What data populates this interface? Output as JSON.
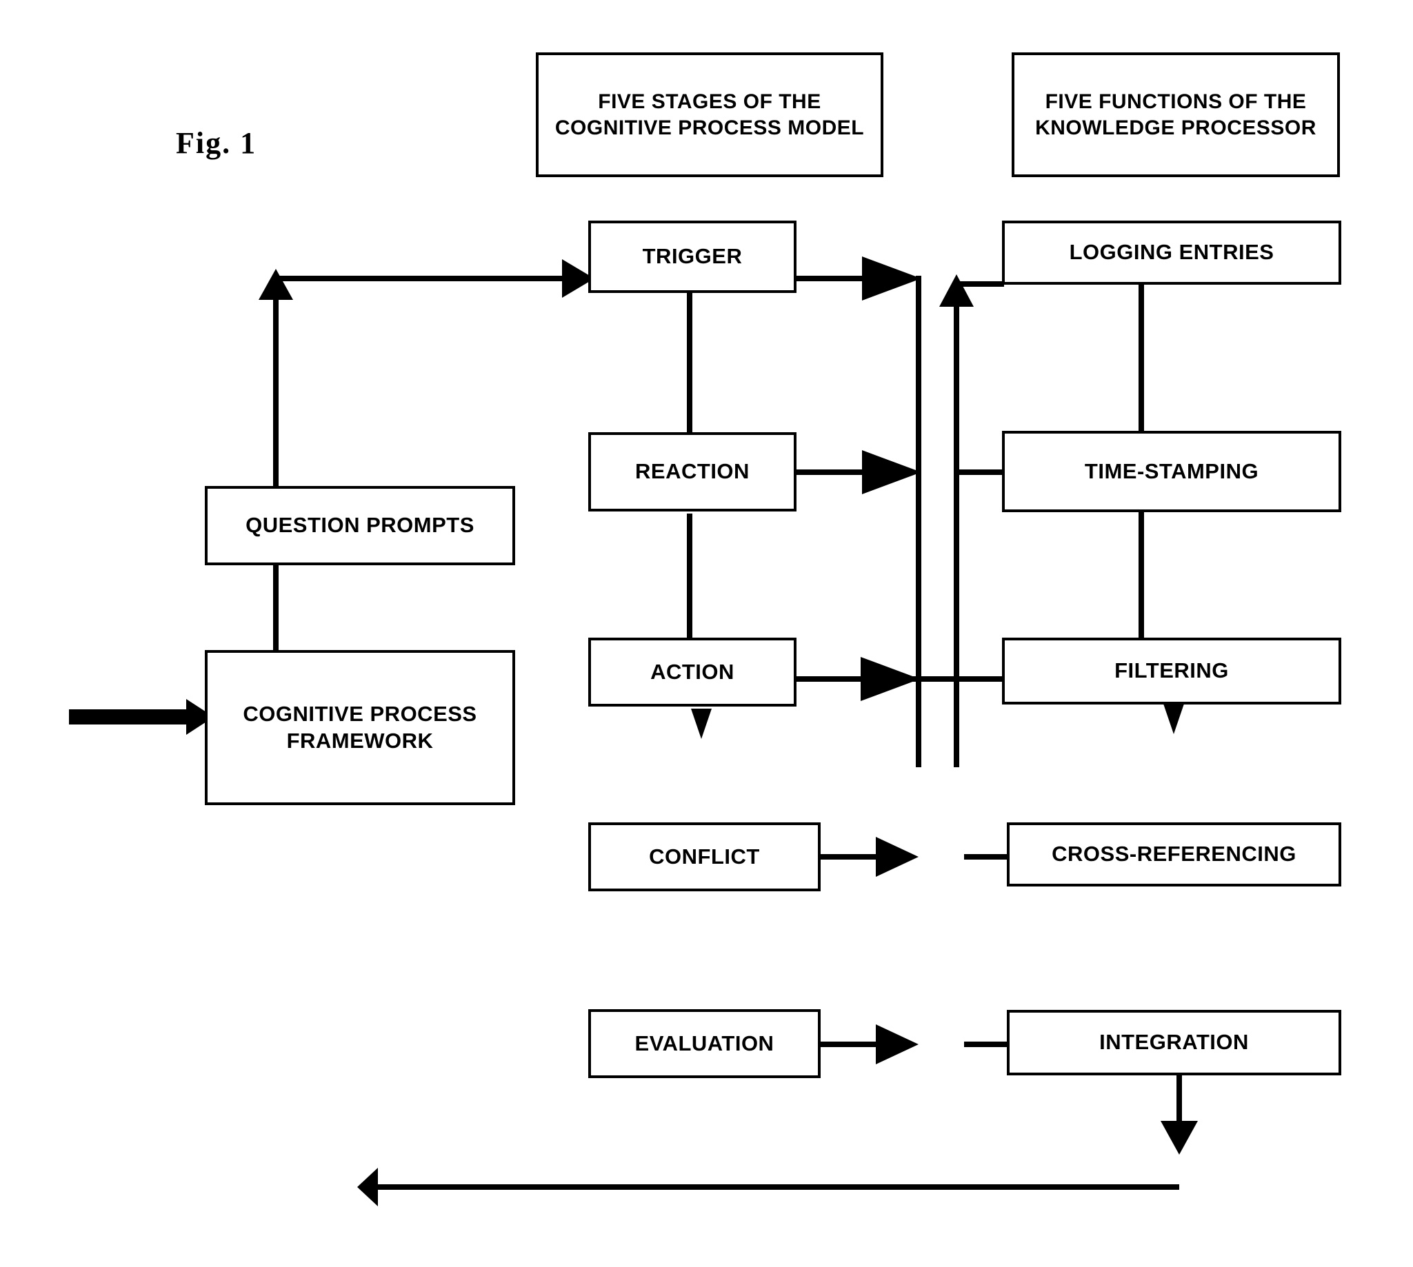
{
  "figure": {
    "label": "Fig.  1"
  },
  "headers": [
    {
      "id": "stages-header",
      "text": "FIVE STAGES OF THE COGNITIVE PROCESS MODEL"
    },
    {
      "id": "functions-header",
      "text": "FIVE FUNCTIONS OF THE KNOWLEDGE PROCESSOR"
    }
  ],
  "left_column": [
    {
      "id": "question-prompts",
      "text": "QUESTION PROMPTS"
    },
    {
      "id": "cognitive-process-framework",
      "text": "COGNITIVE PROCESS FRAMEWORK"
    }
  ],
  "stages": [
    {
      "id": "trigger",
      "text": "TRIGGER"
    },
    {
      "id": "reaction",
      "text": "REACTION"
    },
    {
      "id": "action",
      "text": "ACTION"
    },
    {
      "id": "conflict",
      "text": "CONFLICT"
    },
    {
      "id": "evaluation",
      "text": "EVALUATION"
    }
  ],
  "functions": [
    {
      "id": "logging-entries",
      "text": "LOGGING ENTRIES"
    },
    {
      "id": "time-stamping",
      "text": "TIME-STAMPING"
    },
    {
      "id": "filtering",
      "text": "FILTERING"
    },
    {
      "id": "cross-referencing",
      "text": "CROSS-REFERENCING"
    },
    {
      "id": "integration",
      "text": "INTEGRATION"
    }
  ],
  "colors": {
    "stroke": "#000000",
    "background": "#ffffff",
    "text": "#000000"
  }
}
